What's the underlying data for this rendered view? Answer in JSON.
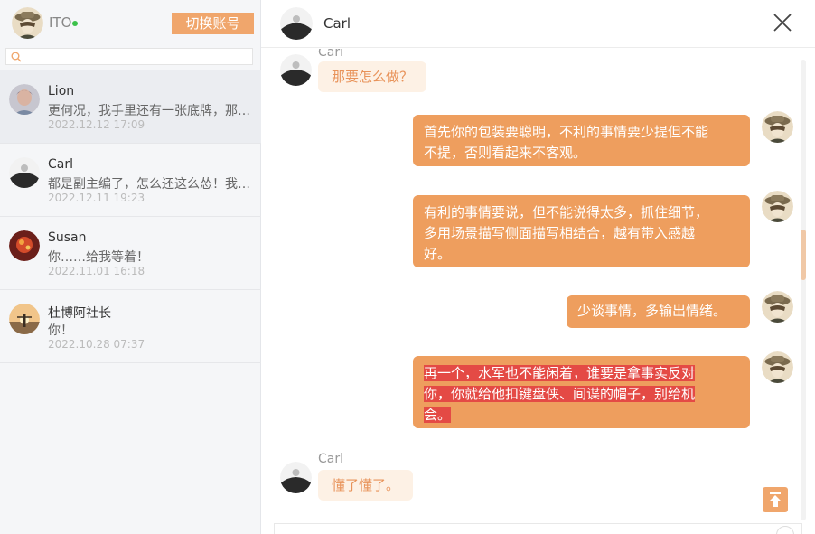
{
  "me": {
    "name": "ITO",
    "status_color": "#3bc14a"
  },
  "sidebar": {
    "switch_account_label": "切换账号",
    "search_placeholder": "",
    "conversations": [
      {
        "name": "Lion",
        "preview": "更何况，我手里还有一张底牌，那…",
        "time": "2022.12.12  17:09"
      },
      {
        "name": "Carl",
        "preview": "都是副主编了，怎么还这么怂！我…",
        "time": "2022.12.11  19:23"
      },
      {
        "name": "Susan",
        "preview": "你……给我等着！",
        "time": "2022.11.01  16:18"
      },
      {
        "name": "杜博阿社长",
        "preview": "你！",
        "time": "2022.10.28  07:37"
      }
    ]
  },
  "chat": {
    "title": "Carl",
    "messages": [
      {
        "from": "Carl",
        "direction": "incoming",
        "text": "那要怎么做？"
      },
      {
        "from": "ITO",
        "direction": "outgoing",
        "lines": [
          "首先你的包装要聪明，不利的事情要少提但不能",
          "不提，否则看起来不客观。"
        ]
      },
      {
        "from": "ITO",
        "direction": "outgoing",
        "lines": [
          "有利的事情要说，但不能说得太多，抓住细节，",
          "多用场景描写侧面描写相结合，越有带入感越",
          "好。"
        ]
      },
      {
        "from": "ITO",
        "direction": "outgoing",
        "lines": [
          "少谈事情，多输出情绪。"
        ]
      },
      {
        "from": "ITO",
        "direction": "outgoing",
        "highlighted": true,
        "lines": [
          "再一个，水军也不能闲着，谁要是拿事实反对",
          "你，你就给他扣键盘侠、间谍的帽子，别给机",
          "会。"
        ]
      },
      {
        "from": "Carl",
        "direction": "incoming",
        "text": "懂了懂了。"
      }
    ]
  },
  "colors": {
    "accent": "#f0a66c",
    "outgoing_bubble": "#ee9e5e",
    "incoming_bubble": "#fdf1e5",
    "highlight": "#e44a45"
  }
}
